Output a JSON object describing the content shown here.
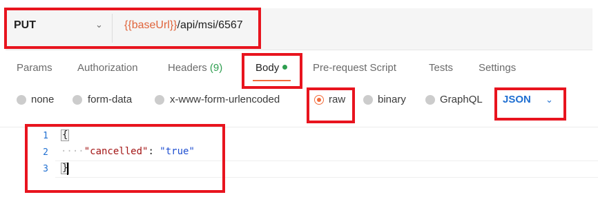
{
  "request": {
    "method": "PUT",
    "url_variable": "{{baseUrl}}",
    "url_path": "/api/msi/6567"
  },
  "tabs": [
    {
      "label": "Params"
    },
    {
      "label": "Authorization"
    },
    {
      "label": "Headers",
      "count": "(9)"
    },
    {
      "label": "Body",
      "active": true
    },
    {
      "label": "Pre-request Script"
    },
    {
      "label": "Tests"
    },
    {
      "label": "Settings"
    }
  ],
  "body_types": [
    {
      "label": "none"
    },
    {
      "label": "form-data"
    },
    {
      "label": "x-www-form-urlencoded"
    },
    {
      "label": "raw",
      "selected": true
    },
    {
      "label": "binary"
    },
    {
      "label": "GraphQL"
    }
  ],
  "raw_format": "JSON",
  "editor": {
    "lines": [
      {
        "number": "1",
        "text": "{"
      },
      {
        "number": "2",
        "key": "\"cancelled\"",
        "separator": ": ",
        "value": "\"true\""
      },
      {
        "number": "3",
        "text": "}"
      }
    ],
    "indent_marker": "····"
  },
  "colors": {
    "accent": "#f26b3a",
    "highlight": "#e8141e",
    "url_variable": "#e0643b",
    "json_select": "#1f6fd1",
    "count_green": "#2e9e4f"
  },
  "icons": [
    "chevron-down-icon",
    "active-dot-icon",
    "radio-icon"
  ]
}
